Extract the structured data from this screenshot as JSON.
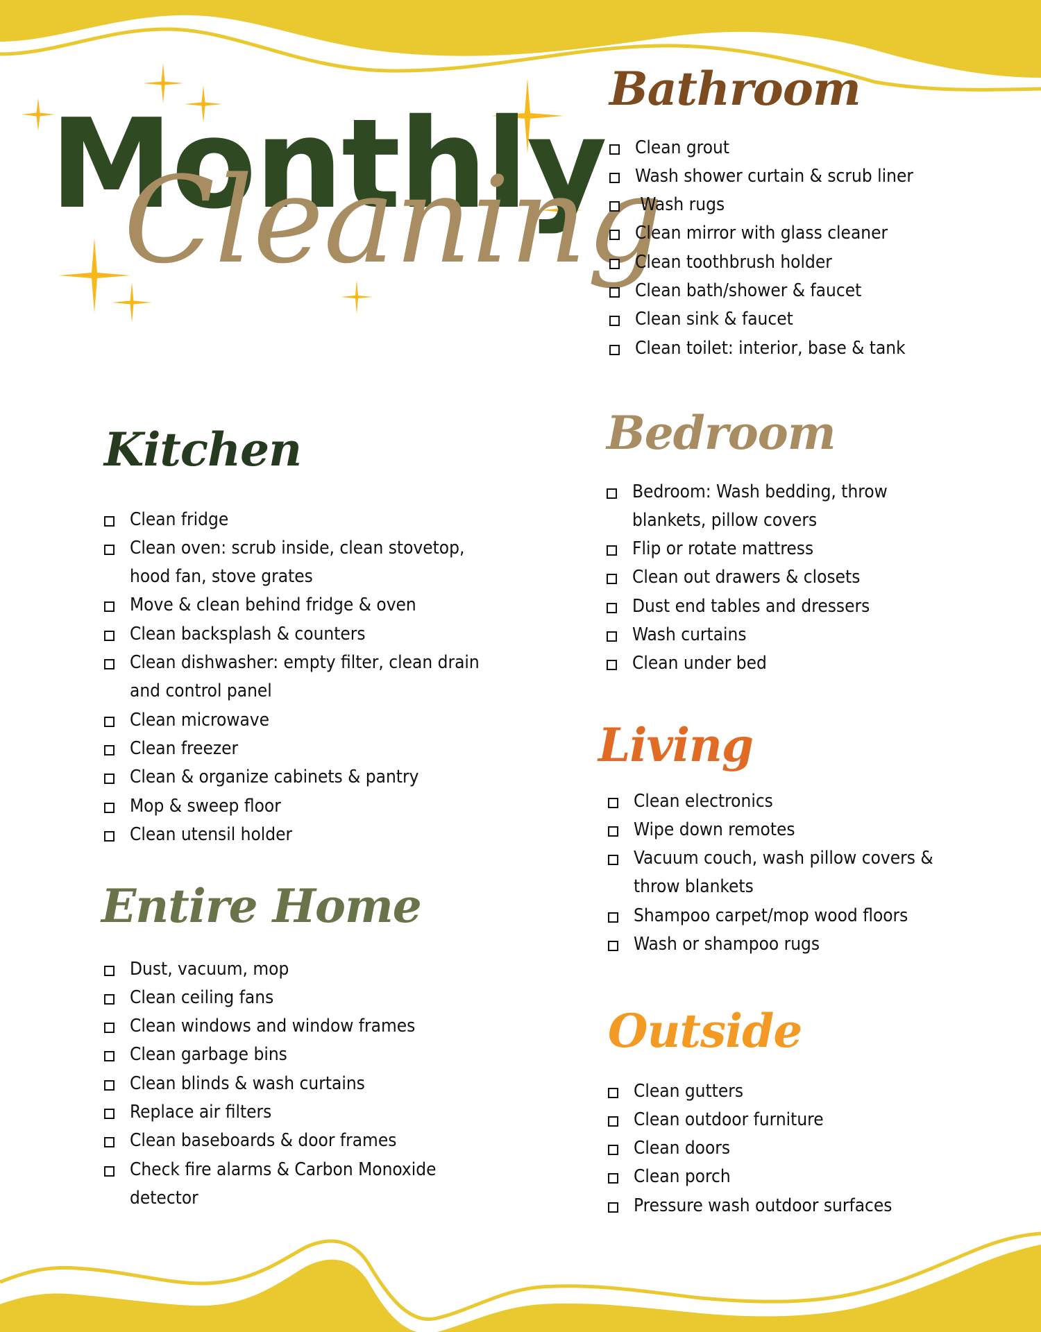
{
  "title": {
    "line1": "Monthly",
    "line2": "Cleaning"
  },
  "colors": {
    "wave_yellow": "#e9c830",
    "sparkle_gold": "#f7b81c",
    "title_green": "#2f4a22",
    "title_tan": "#a88d63",
    "bathroom": "#7c4b1f",
    "bedroom": "#a88d63",
    "living": "#e06b25",
    "outside": "#f39a25",
    "kitchen": "#263a20",
    "entire_home": "#69744a"
  },
  "sections": {
    "bathroom": {
      "heading": "Bathroom",
      "items": [
        "Clean grout",
        "Wash shower curtain & scrub liner",
        " Wash rugs",
        "Clean mirror with glass cleaner",
        "Clean toothbrush holder",
        "Clean bath/shower & faucet",
        "Clean sink & faucet",
        "Clean toilet: interior, base & tank"
      ]
    },
    "bedroom": {
      "heading": "Bedroom",
      "items": [
        "Bedroom: Wash bedding, throw blankets, pillow covers",
        "Flip or rotate mattress",
        "Clean out drawers & closets",
        "Dust end tables and dressers",
        "Wash curtains",
        "Clean under bed"
      ]
    },
    "living": {
      "heading": "Living",
      "items": [
        "Clean electronics",
        "Wipe down remotes",
        "Vacuum couch, wash pillow covers & throw blankets",
        "Shampoo carpet/mop wood floors",
        "Wash or shampoo rugs"
      ]
    },
    "outside": {
      "heading": "Outside",
      "items": [
        "Clean gutters",
        "Clean outdoor furniture",
        "Clean doors",
        "Clean porch",
        "Pressure wash outdoor surfaces"
      ]
    },
    "kitchen": {
      "heading": "Kitchen",
      "items": [
        "Clean fridge",
        "Clean oven: scrub inside, clean stovetop, hood fan, stove grates",
        "Move & clean behind fridge & oven",
        "Clean backsplash & counters",
        "Clean dishwasher: empty filter, clean drain and control panel",
        "Clean microwave",
        "Clean freezer",
        "Clean & organize cabinets & pantry",
        "Mop & sweep floor",
        "Clean utensil holder"
      ]
    },
    "entire_home": {
      "heading": "Entire Home",
      "items": [
        "Dust, vacuum, mop",
        "Clean ceiling fans",
        "Clean windows and window frames",
        "Clean garbage bins",
        "Clean blinds & wash curtains",
        "Replace air filters",
        "Clean baseboards & door frames",
        "Check fire alarms & Carbon Monoxide detector"
      ]
    }
  }
}
